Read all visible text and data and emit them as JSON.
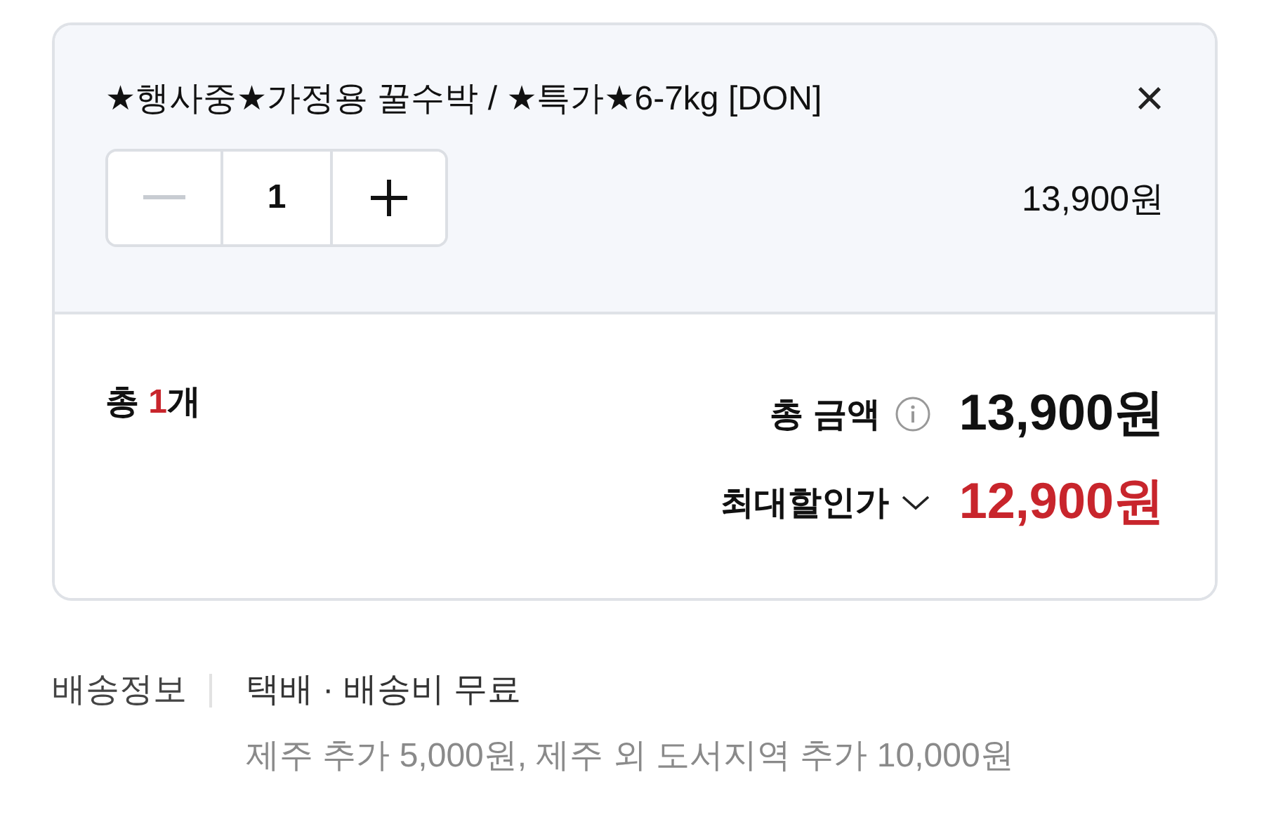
{
  "item": {
    "title": "★행사중★가정용 꿀수박 / ★특가★6-7kg [DON]",
    "close": "×",
    "quantity": {
      "value": "1",
      "minus_disabled": true
    },
    "price": "13,900원"
  },
  "summary": {
    "count": {
      "label": "총",
      "value": "1",
      "unit": "개"
    },
    "total": {
      "label": "총 금액",
      "amount": "13,900원"
    },
    "discount": {
      "label": "최대할인가",
      "expanded": false,
      "amount": "12,900원"
    }
  },
  "shipping": {
    "label": "배송정보",
    "method": "택배 · 배송비 무료",
    "note": "제주 추가 5,000원, 제주 외 도서지역 추가 10,000원"
  }
}
